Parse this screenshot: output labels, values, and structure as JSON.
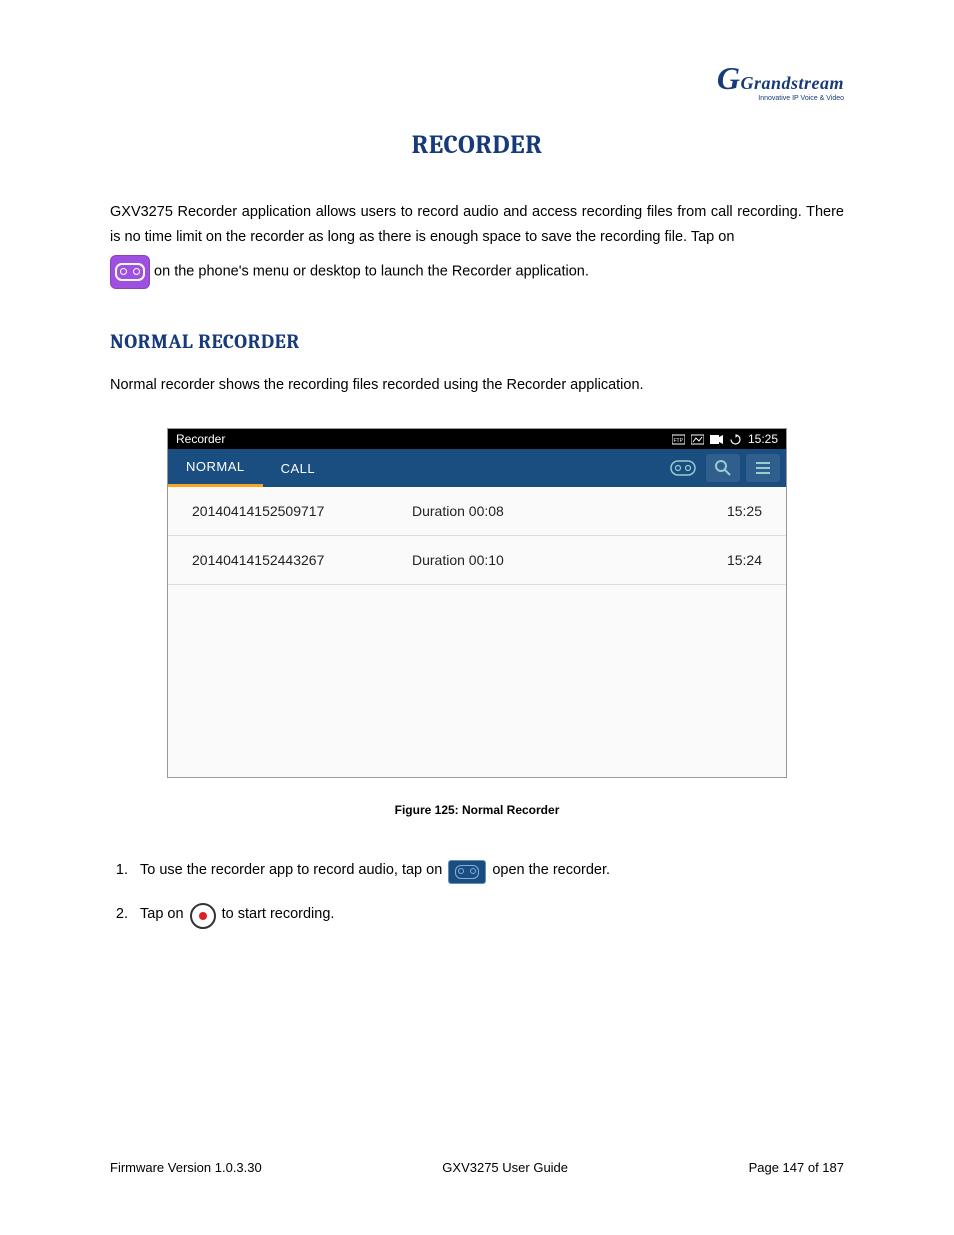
{
  "logo": {
    "brand": "Grandstream",
    "tagline": "Innovative IP Voice & Video"
  },
  "title": "RECORDER",
  "intro_p1": "GXV3275 Recorder application allows users to record audio and access recording files from call recording. There is no time limit on the recorder as long as there is enough space to save the recording file. Tap on",
  "intro_p2": " on the phone's menu or desktop to launch the Recorder application.",
  "section_normal": "NORMAL RECORDER",
  "normal_desc": "Normal recorder shows the recording files recorded using the Recorder application.",
  "screenshot": {
    "app_title": "Recorder",
    "status_time": "15:25",
    "tabs": {
      "normal": "NORMAL",
      "call": "CALL"
    },
    "rows": [
      {
        "name": "20140414152509717",
        "duration": "Duration 00:08",
        "time": "15:25"
      },
      {
        "name": "20140414152443267",
        "duration": "Duration 00:10",
        "time": "15:24"
      }
    ]
  },
  "figure_caption": "Figure 125: Normal Recorder",
  "step1_a": "To use the recorder app to record audio, tap on ",
  "step1_b": " open the recorder.",
  "step2_a": "Tap on ",
  "step2_b": " to start recording.",
  "footer": {
    "left": "Firmware Version 1.0.3.30",
    "center": "GXV3275 User Guide",
    "right": "Page 147 of 187"
  }
}
